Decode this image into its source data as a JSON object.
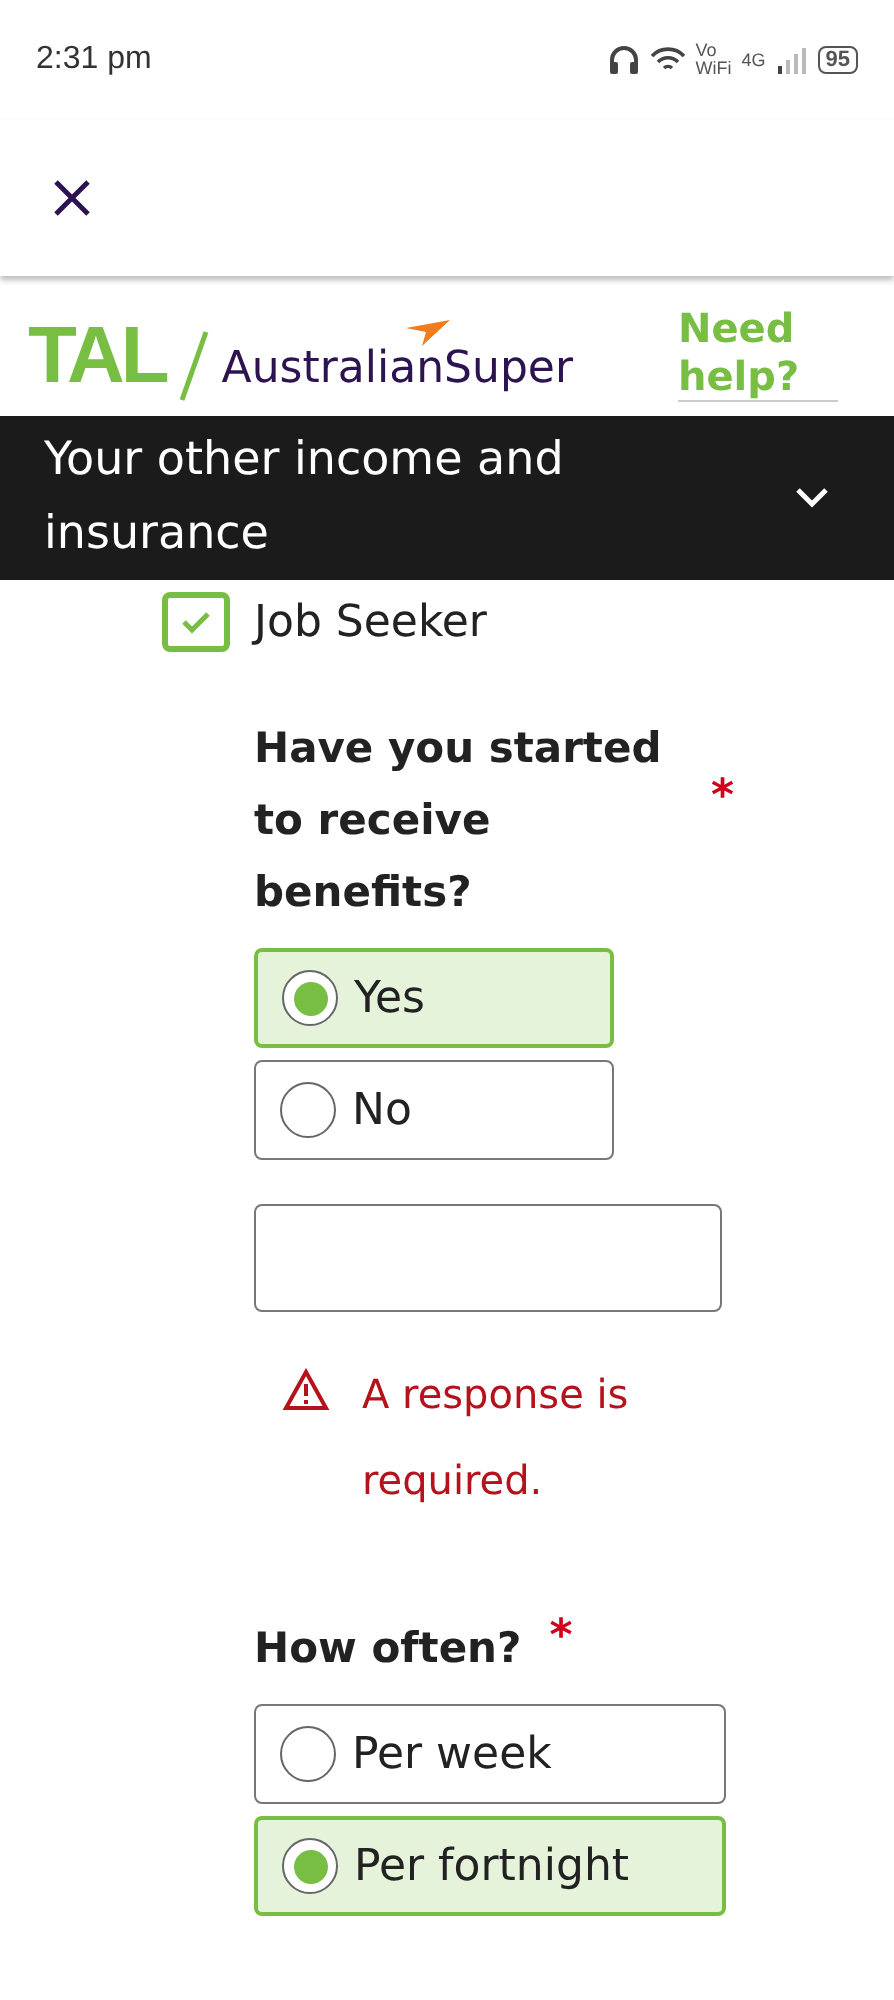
{
  "status_bar": {
    "time": "2:31 pm",
    "vowifi": "Vo WiFi",
    "network": "4G",
    "battery": "95"
  },
  "header": {
    "brand_left": "TAL",
    "brand_right": "AustralianSuper",
    "help_link": "Need help?"
  },
  "section_bar": {
    "title": "Your other income and insurance",
    "expanded": false
  },
  "job_seeker": {
    "label": "Job Seeker",
    "checked": true
  },
  "benefits_question": {
    "label": "Have you started to receive benefits?",
    "required_mark": "*",
    "options": [
      {
        "label": "Yes",
        "selected": true
      },
      {
        "label": "No",
        "selected": false
      }
    ]
  },
  "amount_field": {
    "error": "A response is required."
  },
  "frequency_question": {
    "label": "How often?",
    "required_mark": "*",
    "options": [
      {
        "label": "Per week",
        "selected": false
      },
      {
        "label": "Per fortnight",
        "selected": true
      }
    ]
  }
}
